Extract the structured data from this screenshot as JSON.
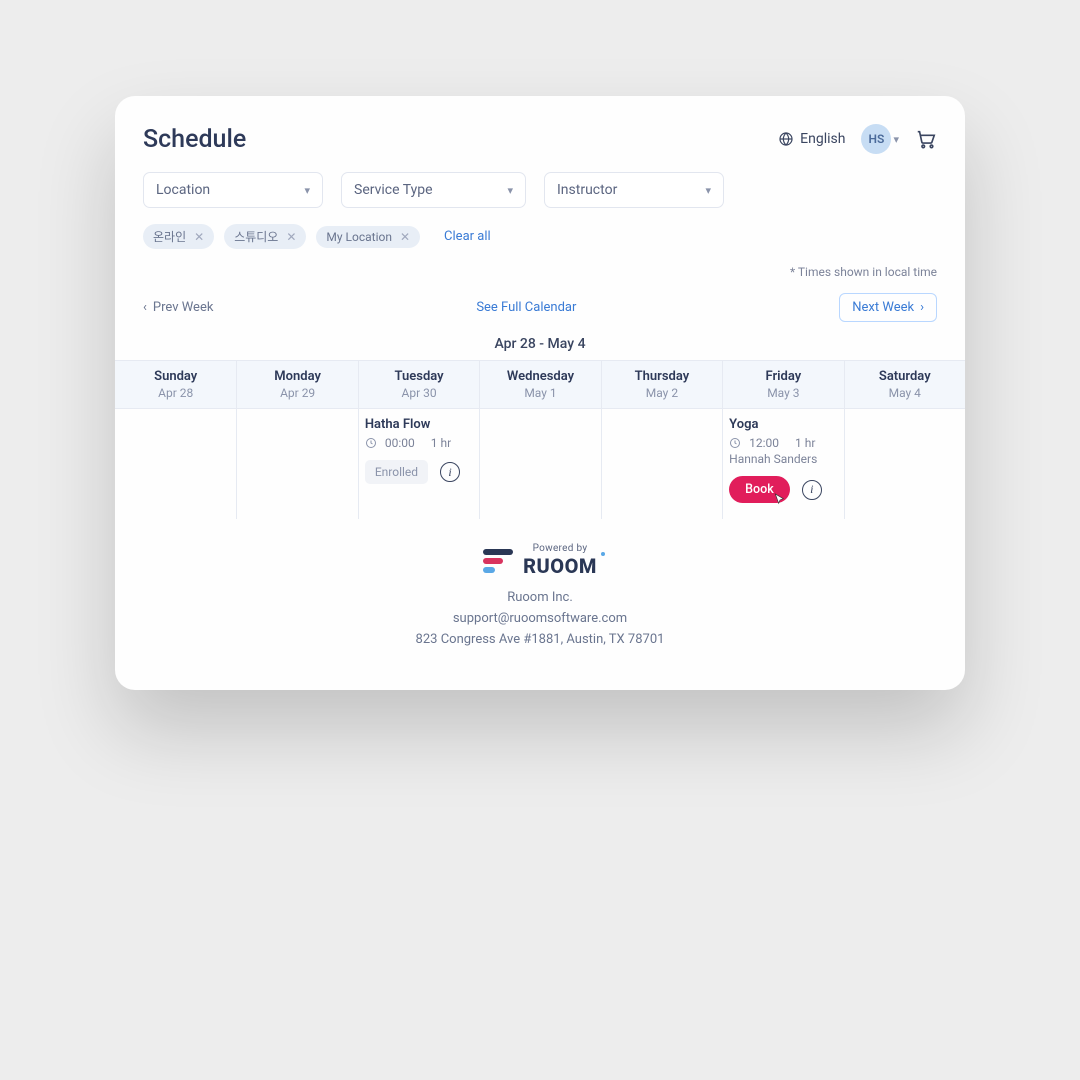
{
  "header": {
    "title": "Schedule",
    "language": "English",
    "avatar_initials": "HS"
  },
  "filters": {
    "location": "Location",
    "service_type": "Service Type",
    "instructor": "Instructor",
    "chips": [
      "온라인",
      "스튜디오",
      "My Location"
    ],
    "clear_all": "Clear all"
  },
  "note": "* Times shown in local time",
  "nav": {
    "prev": "Prev Week",
    "full": "See Full Calendar",
    "next": "Next Week",
    "range": "Apr 28 - May 4"
  },
  "days": [
    {
      "name": "Sunday",
      "date": "Apr 28"
    },
    {
      "name": "Monday",
      "date": "Apr 29"
    },
    {
      "name": "Tuesday",
      "date": "Apr 30"
    },
    {
      "name": "Wednesday",
      "date": "May 1"
    },
    {
      "name": "Thursday",
      "date": "May 2"
    },
    {
      "name": "Friday",
      "date": "May 3"
    },
    {
      "name": "Saturday",
      "date": "May 4"
    }
  ],
  "events": {
    "tue": {
      "name": "Hatha Flow",
      "time": "00:00",
      "duration": "1 hr",
      "status": "Enrolled"
    },
    "fri": {
      "name": "Yoga",
      "time": "12:00",
      "duration": "1 hr",
      "instructor": "Hannah Sanders",
      "book": "Book"
    }
  },
  "footer": {
    "powered": "Powered by",
    "brand": "RUOOM",
    "company": "Ruoom Inc.",
    "email": "support@ruoomsoftware.com",
    "address": "823 Congress Ave #1881, Austin, TX 78701"
  },
  "info_glyph": "i"
}
